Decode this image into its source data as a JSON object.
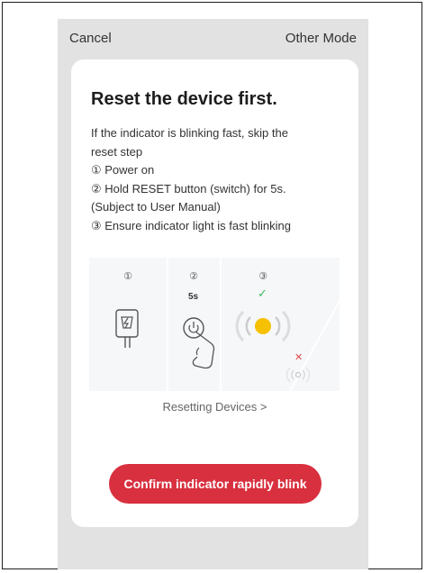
{
  "header": {
    "cancel_label": "Cancel",
    "other_mode_label": "Other Mode"
  },
  "card": {
    "title": "Reset the device first.",
    "description_lines": [
      "If the indicator is blinking fast, skip the",
      "reset step",
      "① Power on",
      "② Hold RESET button (switch) for 5s.",
      "(Subject to User Manual)",
      "③ Ensure indicator light is fast blinking"
    ],
    "illustration": {
      "steps": [
        "①",
        "②",
        "③"
      ],
      "duration_label": "5s",
      "icons": [
        "plug-icon",
        "power-button-icon",
        "hand-icon",
        "blinking-light-icon",
        "check-icon",
        "cross-icon"
      ]
    },
    "resetting_link": "Resetting Devices >",
    "confirm_label": "Confirm indicator rapidly blink"
  },
  "colors": {
    "accent": "#d8303f",
    "indicator": "#f6c100",
    "check": "#3ebc5b",
    "cross": "#e14b4b",
    "background": "#e2e2e2"
  }
}
